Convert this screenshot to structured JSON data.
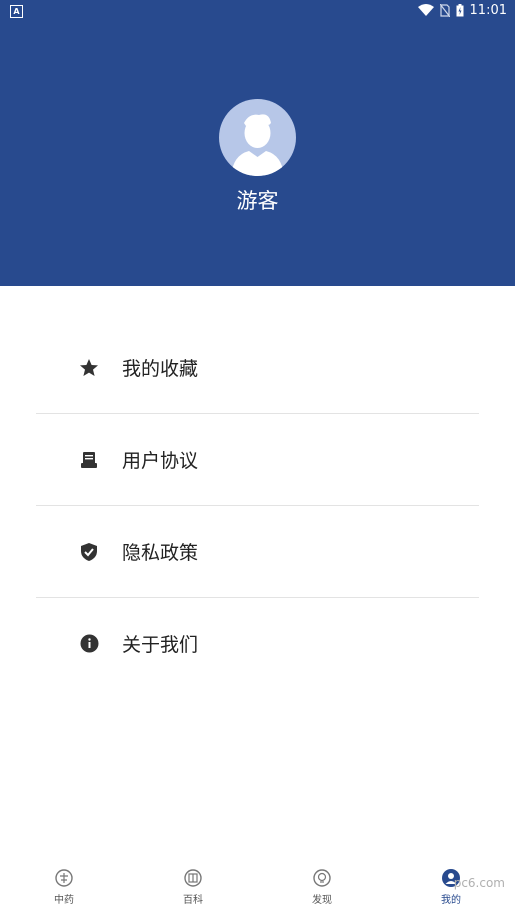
{
  "status_bar": {
    "time": "11:01",
    "left_icon": "A"
  },
  "profile": {
    "name": "游客",
    "avatar_color": "#b7c7e8",
    "header_color": "#284a8e"
  },
  "menu": [
    {
      "label": "我的收藏",
      "icon": "star-icon"
    },
    {
      "label": "用户协议",
      "icon": "document-icon"
    },
    {
      "label": "隐私政策",
      "icon": "shield-check-icon"
    },
    {
      "label": "关于我们",
      "icon": "info-icon"
    }
  ],
  "tabs": [
    {
      "label": "中药",
      "icon": "herb-icon"
    },
    {
      "label": "百科",
      "icon": "book-icon"
    },
    {
      "label": "发现",
      "icon": "discover-icon"
    },
    {
      "label": "我的",
      "icon": "profile-icon",
      "active": true
    }
  ],
  "watermark": "pc6.com"
}
